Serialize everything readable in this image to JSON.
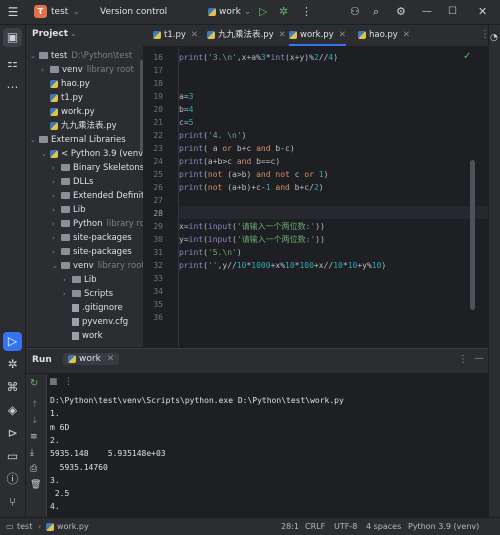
{
  "titlebar": {
    "project_badge": "T",
    "project_name": "test",
    "vcs_label": "Version control",
    "run_config": "work"
  },
  "project_panel": {
    "title": "Project",
    "tree": [
      {
        "label": "test",
        "hint": "D:\\Python\\test",
        "level": 0,
        "kind": "folder",
        "expanded": true
      },
      {
        "label": "venv",
        "hint": "library root",
        "level": 1,
        "kind": "folder",
        "expanded": false
      },
      {
        "label": "hao.py",
        "hint": "",
        "level": 1,
        "kind": "py"
      },
      {
        "label": "t1.py",
        "hint": "",
        "level": 1,
        "kind": "py"
      },
      {
        "label": "work.py",
        "hint": "",
        "level": 1,
        "kind": "py"
      },
      {
        "label": "九九乘法表.py",
        "hint": "",
        "level": 1,
        "kind": "py"
      },
      {
        "label": "External Libraries",
        "hint": "",
        "level": 0,
        "kind": "lib",
        "expanded": true
      },
      {
        "label": "< Python 3.9 (venv) >",
        "hint": "",
        "level": 1,
        "kind": "py",
        "expanded": true
      },
      {
        "label": "Binary Skeletons",
        "hint": "",
        "level": 2,
        "kind": "folder",
        "expanded": false
      },
      {
        "label": "DLLs",
        "hint": "",
        "level": 2,
        "kind": "folder",
        "expanded": false
      },
      {
        "label": "Extended Definitions",
        "hint": "",
        "level": 2,
        "kind": "folder",
        "expanded": false
      },
      {
        "label": "Lib",
        "hint": "",
        "level": 2,
        "kind": "folder",
        "expanded": false
      },
      {
        "label": "Python",
        "hint": "library root",
        "level": 2,
        "kind": "folder",
        "expanded": false
      },
      {
        "label": "site-packages",
        "hint": "",
        "level": 2,
        "kind": "folder",
        "expanded": false
      },
      {
        "label": "site-packages",
        "hint": "",
        "level": 2,
        "kind": "folder",
        "expanded": false
      },
      {
        "label": "venv",
        "hint": "library root",
        "level": 2,
        "kind": "folder",
        "expanded": true
      },
      {
        "label": "Lib",
        "hint": "",
        "level": 3,
        "kind": "folder",
        "expanded": false
      },
      {
        "label": "Scripts",
        "hint": "",
        "level": 3,
        "kind": "folder",
        "expanded": false
      },
      {
        "label": ".gitignore",
        "hint": "",
        "level": 3,
        "kind": "file"
      },
      {
        "label": "pyvenv.cfg",
        "hint": "",
        "level": 3,
        "kind": "file"
      },
      {
        "label": "work",
        "hint": "",
        "level": 3,
        "kind": "file"
      }
    ]
  },
  "editor": {
    "tabs": [
      {
        "label": "t1.py",
        "active": false
      },
      {
        "label": "九九乘法表.py",
        "active": false
      },
      {
        "label": "work.py",
        "active": true
      },
      {
        "label": "hao.py",
        "active": false
      }
    ],
    "current_line": 28,
    "lines": [
      {
        "n": "16",
        "code": "print('3.\\n',x+a%3*int(x+y)%2//4)"
      },
      {
        "n": "17",
        "code": ""
      },
      {
        "n": "18",
        "code": ""
      },
      {
        "n": "19",
        "code": "a=3"
      },
      {
        "n": "20",
        "code": "b=4"
      },
      {
        "n": "21",
        "code": "c=5"
      },
      {
        "n": "22",
        "code": "print('4. \\n')"
      },
      {
        "n": "23",
        "code": "print( a or b+c and b-c)"
      },
      {
        "n": "24",
        "code": "print(a+b>c and b==c)"
      },
      {
        "n": "25",
        "code": "print(not (a>b) and not c or 1)"
      },
      {
        "n": "26",
        "code": "print(not (a+b)+c-1 and b+c/2)"
      },
      {
        "n": "27",
        "code": ""
      },
      {
        "n": "28",
        "code": ""
      },
      {
        "n": "29",
        "code": "x=int(input('请输入一个两位数:'))"
      },
      {
        "n": "30",
        "code": "y=int(input('请输入一个两位数:'))"
      },
      {
        "n": "31",
        "code": "print('5.\\n')"
      },
      {
        "n": "32",
        "code": "print('',y//10*1000+x%10*100+x//10*10+y%10)"
      },
      {
        "n": "33",
        "code": ""
      },
      {
        "n": "34",
        "code": ""
      },
      {
        "n": "35",
        "code": ""
      },
      {
        "n": "36",
        "code": ""
      }
    ]
  },
  "run_panel": {
    "title": "Run",
    "tab_label": "work",
    "output": [
      "D:\\Python\\test\\venv\\Scripts\\python.exe D:\\Python\\test\\work.py",
      "1.",
      "m 6D",
      "2.",
      "5935.148    5.935148e+03",
      "  5935.14760",
      "3.",
      " 2.5",
      "4."
    ]
  },
  "statusbar": {
    "breadcrumb_project": "test",
    "breadcrumb_file": "work.py",
    "position": "28:1",
    "line_ending": "CRLF",
    "encoding": "UTF-8",
    "indent": "4 spaces",
    "interpreter": "Python 3.9 (venv)"
  },
  "colors": {
    "accent": "#3574f0",
    "keyword": "#cf8e6d",
    "string": "#6aab73",
    "number": "#2aacb8",
    "run_green": "#5fb865"
  }
}
